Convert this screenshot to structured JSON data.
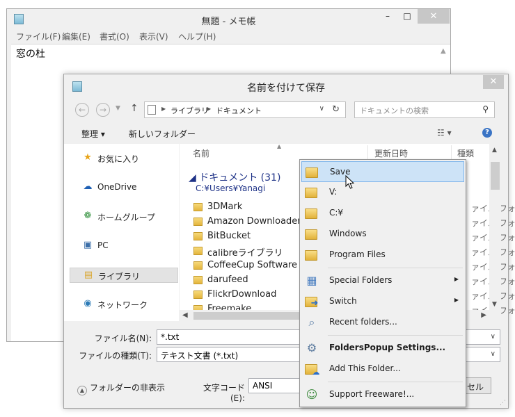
{
  "notepad": {
    "title": "無題 - メモ帳",
    "buttons": {
      "minimize": "–",
      "maximize": "□",
      "close": "✕"
    },
    "menu": [
      "ファイル(F)",
      "編集(E)",
      "書式(O)",
      "表示(V)",
      "ヘルプ(H)"
    ],
    "content": "窓の杜"
  },
  "dialog": {
    "title": "名前を付けて保存",
    "close": "✕",
    "address": {
      "segments": [
        "ライブラリ",
        "ドキュメント"
      ]
    },
    "search_placeholder": "ドキュメントの検索",
    "toolbar": {
      "organize": "整理 ▾",
      "new_folder": "新しいフォルダー",
      "help": "?"
    },
    "nav_items": [
      {
        "label": "お気に入り",
        "icon": "star-icon"
      },
      {
        "label": "OneDrive",
        "icon": "cloud-icon"
      },
      {
        "label": "ホームグループ",
        "icon": "homegroup-icon"
      },
      {
        "label": "PC",
        "icon": "computer-icon"
      },
      {
        "label": "ライブラリ",
        "icon": "library-icon",
        "selected": true
      },
      {
        "label": "ネットワーク",
        "icon": "network-icon"
      }
    ],
    "columns": {
      "name": "名前",
      "date": "更新日時",
      "type": "種類"
    },
    "group": {
      "title": "ドキュメント (31)",
      "path": "C:¥Users¥Yanagi"
    },
    "files": [
      {
        "name": "3DMark",
        "type": "ァイル フォ"
      },
      {
        "name": "Amazon Downloader Lo",
        "type": "ァイル フォ"
      },
      {
        "name": "BitBucket",
        "type": "ァイル フォ"
      },
      {
        "name": "calibreライブラリ",
        "type": "ァイル フォ"
      },
      {
        "name": "CoffeeCup Software",
        "type": "ァイル フォ"
      },
      {
        "name": "darufeed",
        "type": "ァイル フォ"
      },
      {
        "name": "FlickrDownload",
        "type": "ァイル フォ"
      },
      {
        "name": "Freemake",
        "type": "ァイル フォ"
      }
    ],
    "form": {
      "filename_label": "ファイル名(N):",
      "filename_value": "*.txt",
      "filetype_label": "ファイルの種類(T):",
      "filetype_value": "テキスト文書 (*.txt)",
      "encoding_label": "文字コード(E):",
      "encoding_value": "ANSI"
    },
    "hide_folders": "フォルダーの非表示",
    "cancel_partial": "セル"
  },
  "popup_menu": {
    "items": [
      {
        "label": "Save",
        "icon": "folder-icon",
        "highlighted": true
      },
      {
        "label": "V:",
        "icon": "folder-icon"
      },
      {
        "label": "C:¥",
        "icon": "folder-icon"
      },
      {
        "label": "Windows",
        "icon": "folder-icon"
      },
      {
        "label": "Program Files",
        "icon": "folder-icon"
      },
      {
        "label": "Special Folders",
        "icon": "special-folders-icon",
        "submenu": true
      },
      {
        "label": "Switch",
        "icon": "switch-icon",
        "submenu": true
      },
      {
        "label": "Recent folders...",
        "icon": "recent-folders-icon"
      },
      {
        "label": "FoldersPopup Settings...",
        "icon": "settings-icon",
        "bold": true
      },
      {
        "label": "Add This Folder...",
        "icon": "add-folder-icon"
      },
      {
        "label": "Support Freeware!...",
        "icon": "support-icon"
      }
    ]
  },
  "colors": {
    "accent_blue": "#1e3287",
    "menu_highlight": "#cde3f7",
    "menu_highlight_border": "#7eb4ea",
    "help_blue": "#3a74c5"
  }
}
